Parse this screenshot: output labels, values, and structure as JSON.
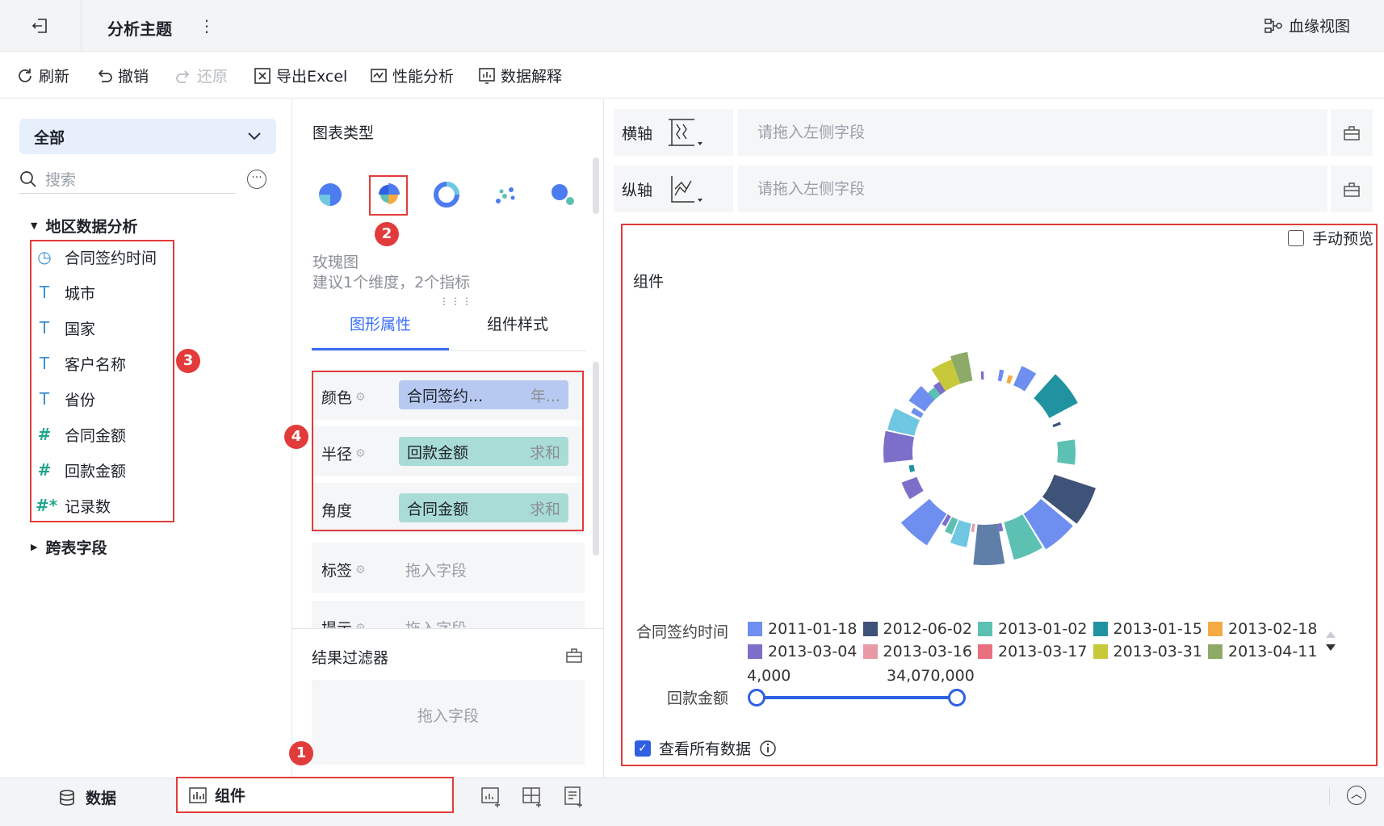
{
  "topbar": {
    "title": "分析主题",
    "more": "⋮",
    "lineage_label": "血缘视图"
  },
  "toolbar": {
    "refresh": "刷新",
    "undo": "撤销",
    "redo": "还原",
    "export_excel": "导出Excel",
    "perf_analysis": "性能分析",
    "data_explain": "数据解释"
  },
  "left_panel": {
    "scope": "全部",
    "search_placeholder": "搜索",
    "group_main": "地区数据分析",
    "fields": [
      {
        "name": "合同签约时间",
        "type": "time"
      },
      {
        "name": "城市",
        "type": "text"
      },
      {
        "name": "国家",
        "type": "text"
      },
      {
        "name": "客户名称",
        "type": "text"
      },
      {
        "name": "省份",
        "type": "text"
      },
      {
        "name": "合同金额",
        "type": "number"
      },
      {
        "name": "回款金额",
        "type": "number"
      },
      {
        "name": "记录数",
        "type": "count"
      }
    ],
    "group_cross": "跨表字段"
  },
  "mid_panel": {
    "chart_type_title": "图表类型",
    "selected_chart": "玫瑰图",
    "selected_hint": "建议1个维度，2个指标",
    "tabs": [
      "图形属性",
      "组件样式"
    ],
    "active_tab": "图形属性",
    "props": [
      {
        "label": "颜色",
        "field": "合同签约...",
        "agg": "年..."
      },
      {
        "label": "半径",
        "field": "回款金额",
        "agg": "求和"
      },
      {
        "label": "角度",
        "field": "合同金额",
        "agg": "求和"
      },
      {
        "label": "标签",
        "drop": "拖入字段"
      },
      {
        "label": "提示",
        "drop": "拖入字段"
      }
    ],
    "filter_title": "结果过滤器",
    "filter_drop": "拖入字段"
  },
  "right_panel": {
    "x_axis_label": "横轴",
    "x_axis_placeholder": "请拖入左侧字段",
    "y_axis_label": "纵轴",
    "y_axis_placeholder": "请拖入左侧字段",
    "manual_preview": "手动预览",
    "widget_title": "组件",
    "legend_title": "合同签约时间",
    "legend": [
      {
        "label": "2011-01-18",
        "color": "#6e8ff0"
      },
      {
        "label": "2012-06-02",
        "color": "#3f5277"
      },
      {
        "label": "2013-01-02",
        "color": "#5cc1b3"
      },
      {
        "label": "2013-01-15",
        "color": "#2193a0"
      },
      {
        "label": "2013-02-18",
        "color": "#f6aa44"
      },
      {
        "label": "2013-03-04",
        "color": "#7c6fc9"
      },
      {
        "label": "2013-03-16",
        "color": "#e999a6"
      },
      {
        "label": "2013-03-17",
        "color": "#e96f7f"
      },
      {
        "label": "2013-03-31",
        "color": "#c8c83b"
      },
      {
        "label": "2013-04-11",
        "color": "#8daa68"
      }
    ],
    "radius_label": "回款金额",
    "radius_min": "4,000",
    "radius_max": "34,070,000",
    "show_all": "查看所有数据",
    "show_all_checked": true
  },
  "chart_data": {
    "type": "rose",
    "inner_radius_ratio": 0.58,
    "segments": [
      {
        "a0": -20,
        "a1": -10,
        "r": 126,
        "color": "#8daa68"
      },
      {
        "a0": -33,
        "a1": -20,
        "r": 122,
        "color": "#c8c83b"
      },
      {
        "a0": -38,
        "a1": -33,
        "r": 104,
        "color": "#7c6fc9"
      },
      {
        "a0": -45,
        "a1": -38,
        "r": 102,
        "color": "#5cc1b3"
      },
      {
        "a0": -3,
        "a1": -1,
        "r": 100,
        "color": "#7c6fc9"
      },
      {
        "a0": 10,
        "a1": 13,
        "r": 104,
        "color": "#6e8ff0"
      },
      {
        "a0": 17,
        "a1": 20,
        "r": 100,
        "color": "#f6aa44"
      },
      {
        "a0": 23,
        "a1": 33,
        "r": 116,
        "color": "#6e8ff0"
      },
      {
        "a0": 42,
        "a1": 62,
        "r": 130,
        "color": "#2193a0"
      },
      {
        "a0": 68,
        "a1": 70,
        "r": 100,
        "color": "#3f5277"
      },
      {
        "a0": 82,
        "a1": 98,
        "r": 112,
        "color": "#5cc1b3"
      },
      {
        "a0": 108,
        "a1": 128,
        "r": 144,
        "color": "#3f5277"
      },
      {
        "a0": 130,
        "a1": 148,
        "r": 142,
        "color": "#6e8ff0"
      },
      {
        "a0": 149,
        "a1": 165,
        "r": 138,
        "color": "#5cc1b3"
      },
      {
        "a0": 167,
        "a1": 170,
        "r": 100,
        "color": "#7c6fc9"
      },
      {
        "a0": 170,
        "a1": 186,
        "r": 140,
        "color": "#5f7fa8"
      },
      {
        "a0": 188,
        "a1": 190,
        "r": 100,
        "color": "#e999a6"
      },
      {
        "a0": 191,
        "a1": 201,
        "r": 120,
        "color": "#6fc7e2"
      },
      {
        "a0": 202,
        "a1": 207,
        "r": 110,
        "color": "#5cc1b3"
      },
      {
        "a0": 208,
        "a1": 211,
        "r": 104,
        "color": "#7c6fc9"
      },
      {
        "a0": 212,
        "a1": 230,
        "r": 136,
        "color": "#6e8ff0"
      },
      {
        "a0": 238,
        "a1": 250,
        "r": 110,
        "color": "#7c6fc9"
      },
      {
        "a0": 255,
        "a1": 260,
        "r": 96,
        "color": "#2193a0"
      },
      {
        "a0": 264,
        "a1": 282,
        "r": 126,
        "color": "#7c6fc9"
      },
      {
        "a0": 283,
        "a1": 296,
        "r": 124,
        "color": "#6fc7e2"
      },
      {
        "a0": 298,
        "a1": 302,
        "r": 104,
        "color": "#6e8ff0"
      },
      {
        "a0": 304,
        "a1": 316,
        "r": 114,
        "color": "#6e8ff0"
      }
    ]
  },
  "bottombar": {
    "data_tab": "数据",
    "widget_tab": "组件"
  },
  "badges": [
    "1",
    "2",
    "3",
    "4"
  ]
}
